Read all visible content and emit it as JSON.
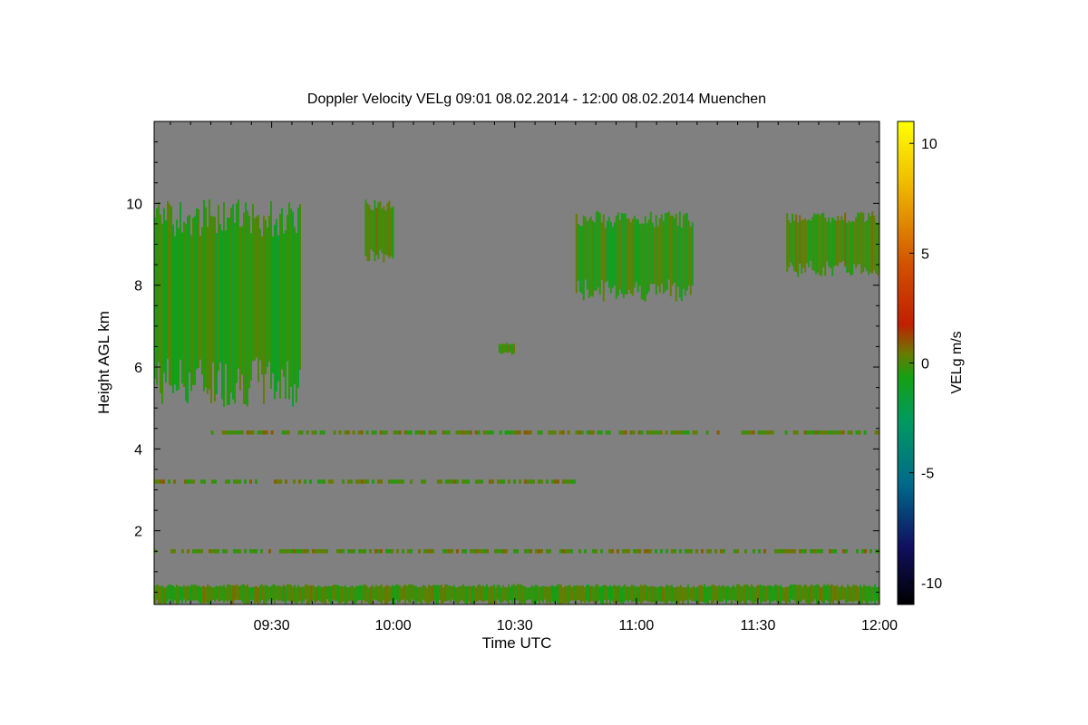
{
  "chart_data": {
    "type": "heatmap",
    "title": "Doppler Velocity VELg   09:01 08.02.2014 - 12:00 08.02.2014 Muenchen",
    "xlabel": "Time UTC",
    "ylabel": "Height AGL km",
    "colorbar_label": "VELg m/s",
    "xlim": [
      "09:01",
      "12:00"
    ],
    "ylim": [
      0.2,
      12.0
    ],
    "x_ticks": [
      "09:30",
      "10:00",
      "10:30",
      "11:00",
      "11:30",
      "12:00"
    ],
    "y_ticks": [
      "2",
      "4",
      "6",
      "8",
      "10"
    ],
    "colorbar_ticks": [
      "10",
      "5",
      "0",
      "-5",
      "-10"
    ],
    "colorbar_range": [
      -11,
      11
    ],
    "background_color": "#808080",
    "colormap": [
      "#000000",
      "#101060",
      "#006a8a",
      "#009a60",
      "#14a014",
      "#6a7a00",
      "#c02000",
      "#d05000",
      "#f0c000",
      "#ffff00"
    ],
    "echo_regions": [
      {
        "label": "cirrus 09:01-09:37",
        "x": [
          "09:01",
          "09:37"
        ],
        "y": [
          5.0,
          10.1
        ],
        "mean_velocity": -0.5
      },
      {
        "label": "cirrus 09:53-10:00",
        "x": [
          "09:53",
          "10:00"
        ],
        "y": [
          8.5,
          10.1
        ],
        "mean_velocity": 0.3
      },
      {
        "label": "cirrus 10:45-11:14",
        "x": [
          "10:45",
          "11:14"
        ],
        "y": [
          7.6,
          9.8
        ],
        "mean_velocity": -0.3
      },
      {
        "label": "cirrus 11:37-12:00",
        "x": [
          "11:37",
          "12:00"
        ],
        "y": [
          8.2,
          9.8
        ],
        "mean_velocity": 0.2
      },
      {
        "label": "small echo 10:26-10:30",
        "x": [
          "10:26",
          "10:30"
        ],
        "y": [
          6.3,
          6.6
        ],
        "mean_velocity": 0.0
      },
      {
        "label": "layer 4.4 km",
        "x": [
          "09:15",
          "12:00"
        ],
        "y": [
          4.35,
          4.45
        ],
        "mean_velocity": 0.5
      },
      {
        "label": "layer 3.2 km",
        "x": [
          "09:01",
          "10:45"
        ],
        "y": [
          3.15,
          3.25
        ],
        "mean_velocity": 0.5
      },
      {
        "label": "layer 1.5 km",
        "x": [
          "09:01",
          "12:00"
        ],
        "y": [
          1.45,
          1.55
        ],
        "mean_velocity": 0.5
      },
      {
        "label": "boundary layer",
        "x": [
          "09:01",
          "12:00"
        ],
        "y": [
          0.2,
          0.7
        ],
        "mean_velocity": 0.0
      }
    ]
  }
}
